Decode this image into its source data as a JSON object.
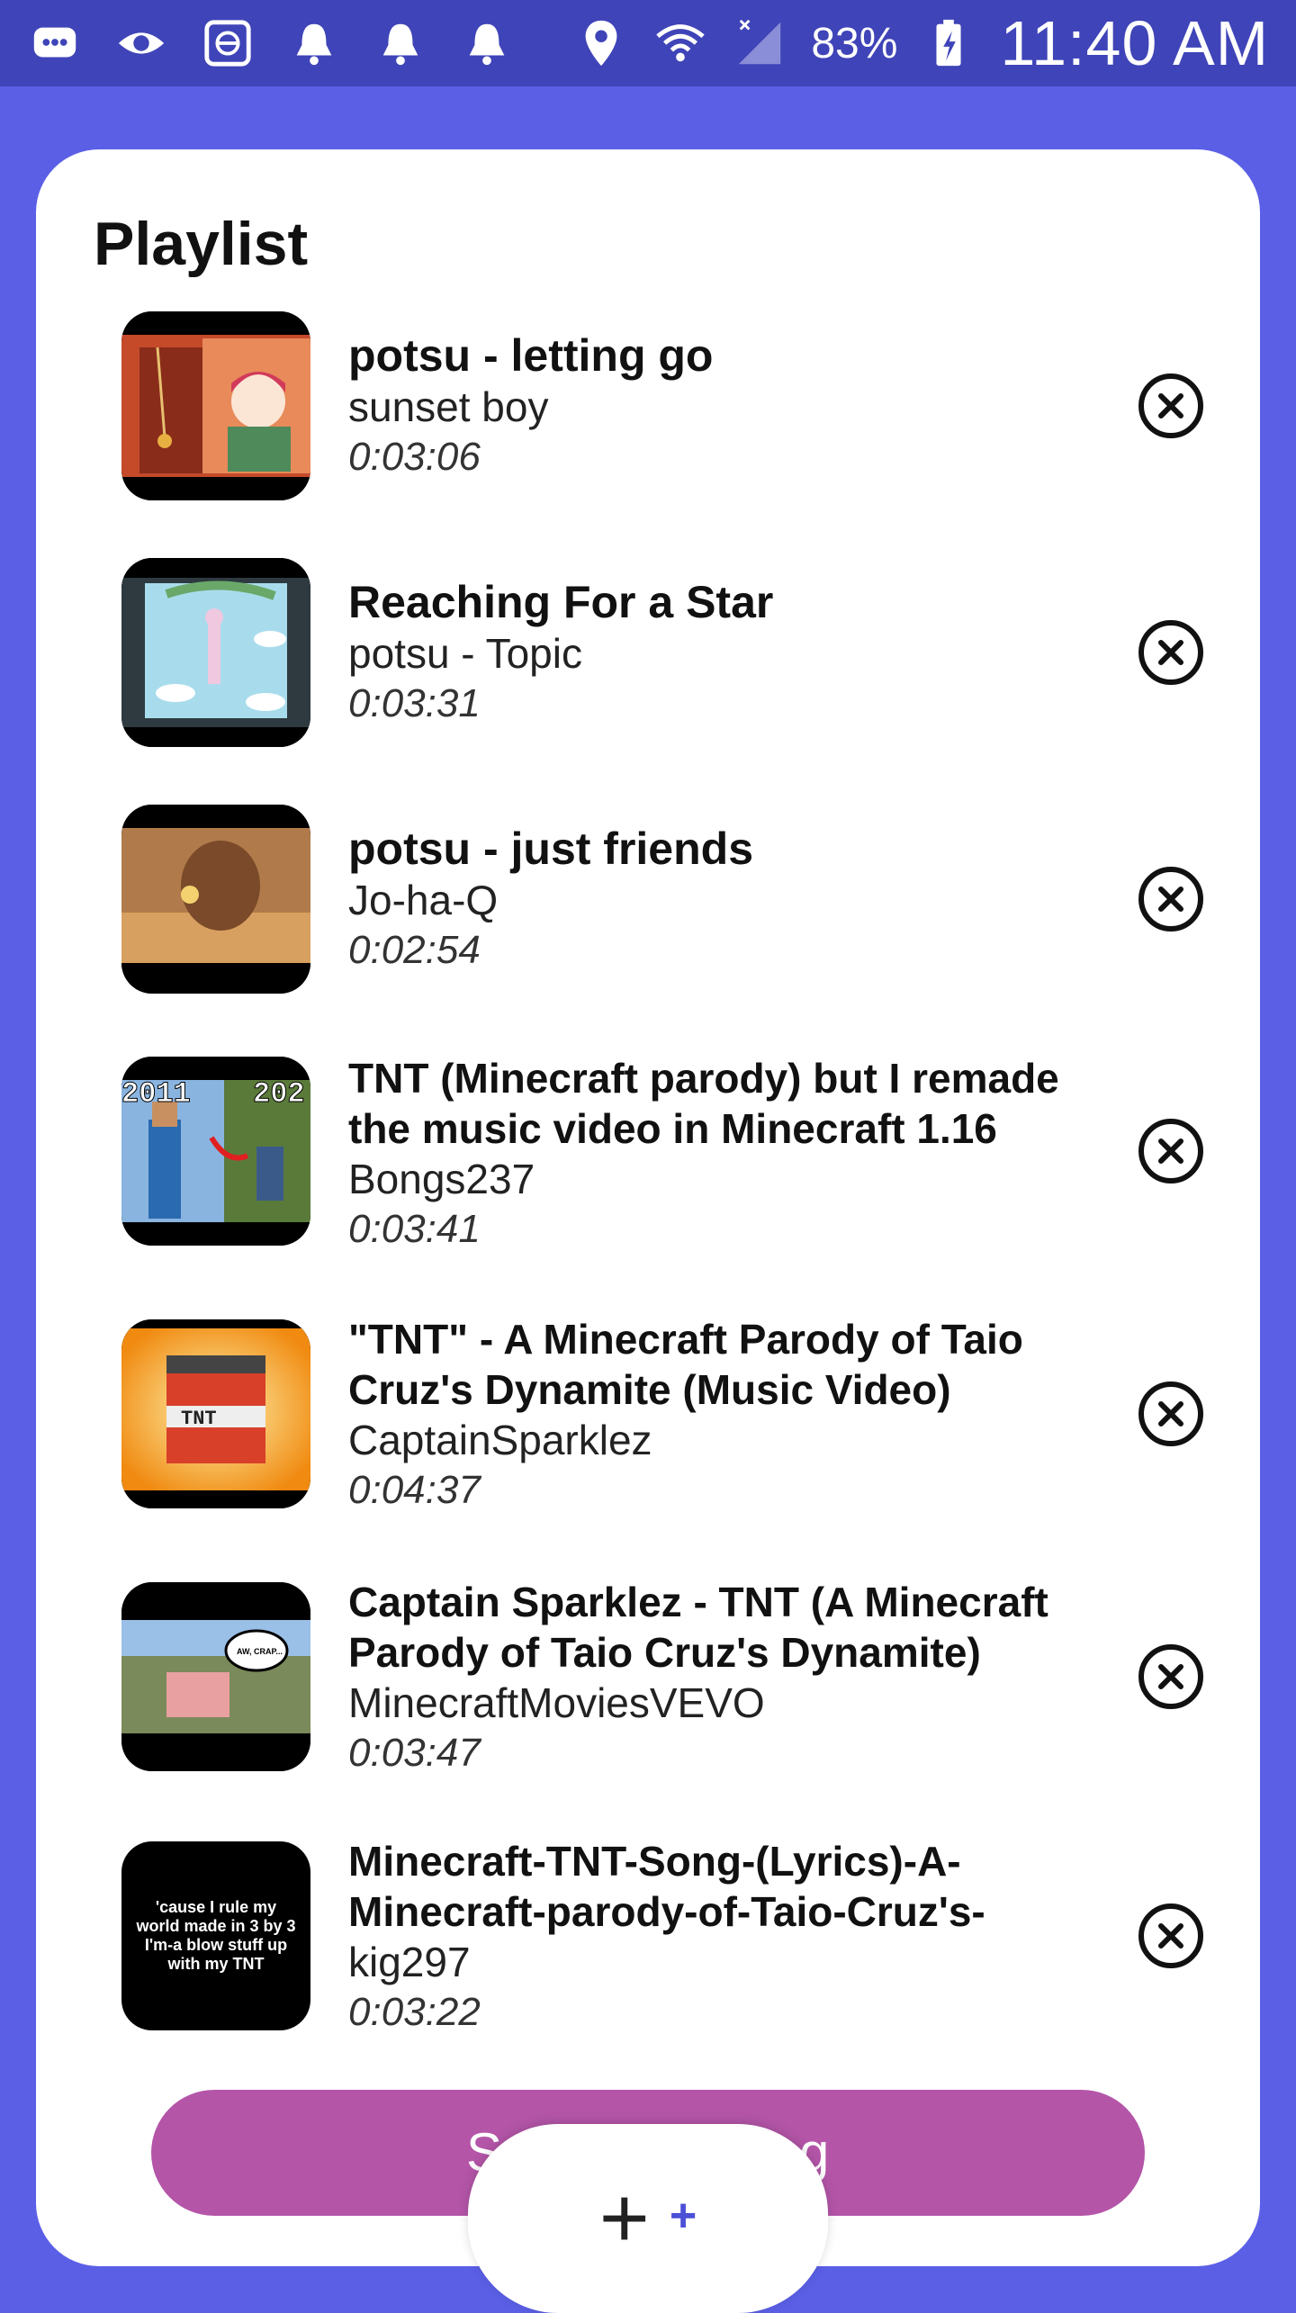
{
  "status_bar": {
    "battery": "83%",
    "time": "11:40 AM"
  },
  "playlist": {
    "title": "Playlist",
    "tracks": [
      {
        "title": "potsu - letting go",
        "artist": "sunset boy",
        "duration": "0:03:06"
      },
      {
        "title": "Reaching For a Star",
        "artist": "potsu - Topic",
        "duration": "0:03:31"
      },
      {
        "title": "potsu - just friends",
        "artist": "Jo-ha-Q",
        "duration": "0:02:54"
      },
      {
        "title": "TNT (Minecraft parody) but I remade the music video in Minecraft 1.16",
        "artist": "Bongs237",
        "duration": "0:03:41"
      },
      {
        "title": "\"TNT\" - A Minecraft Parody of Taio Cruz's Dynamite (Music Video)",
        "artist": "CaptainSparklez",
        "duration": "0:04:37"
      },
      {
        "title": "Captain Sparklez - TNT  (A Minecraft Parody of Taio Cruz's Dynamite)",
        "artist": "MinecraftMoviesVEVO",
        "duration": "0:03:47"
      },
      {
        "title": "Minecraft-TNT-Song-(Lyrics)-A-Minecraft-parody-of-Taio-Cruz's-",
        "artist": "kig297",
        "duration": "0:03:22"
      }
    ],
    "thumb_texts": {
      "year_left": "2011",
      "year_right": "202",
      "tnt_label": "TNT",
      "speech": "AW, CRAP...",
      "lyrics": "'cause I rule my world made in 3 by 3 I'm-a blow stuff up with my TNT"
    }
  },
  "bottom": {
    "start_label": "S",
    "start_label_end": "g",
    "fab_plus": "+",
    "fab_plus_small": "+"
  },
  "colors": {
    "background": "#5b5fe6",
    "status_bar": "#3f44b8",
    "accent_button": "#b455a8",
    "fab_plus_accent": "#4b50d6"
  }
}
